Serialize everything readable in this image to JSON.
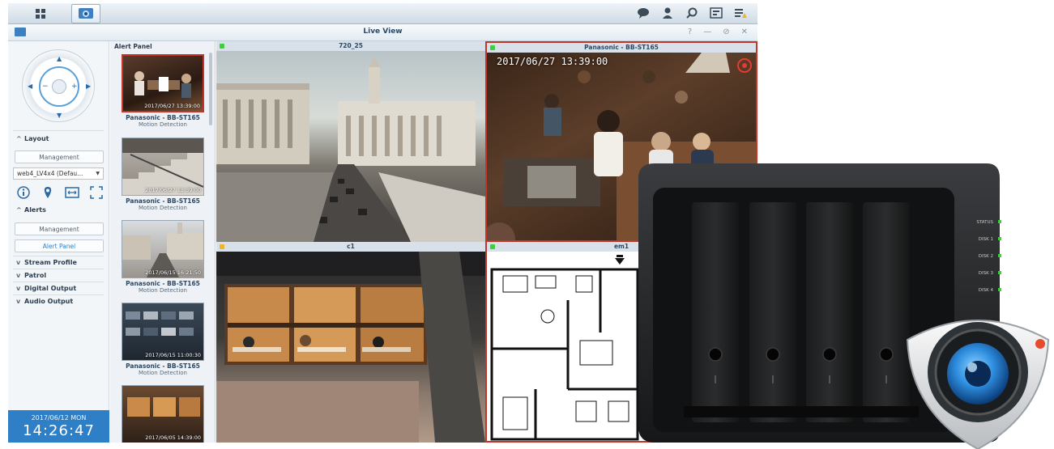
{
  "taskbar": {
    "buttons": [
      "main-menu",
      "surveillance-station"
    ],
    "right_icons": [
      "chat-icon",
      "user-icon",
      "search-icon",
      "widgets-icon",
      "notifications-icon"
    ]
  },
  "window": {
    "title": "Live View",
    "controls": [
      "?",
      "—",
      "⊘",
      "✕"
    ]
  },
  "left_panel": {
    "layout_label": "Layout",
    "layout_management": "Management",
    "layout_select": "web4_LV4x4 (Defau...",
    "alerts_label": "Alerts",
    "alerts_management": "Management",
    "alert_panel_button": "Alert Panel",
    "stream_profile": "Stream Profile",
    "patrol": "Patrol",
    "digital_output": "Digital Output",
    "audio_output": "Audio Output",
    "clock_date": "2017/06/12  MON",
    "clock_time": "14:26:47"
  },
  "alert_panel": {
    "title": "Alert Panel",
    "alerts": [
      {
        "timestamp": "2017/06/27 13:39:00",
        "camera": "Panasonic - BB-ST165",
        "event": "Motion Detection"
      },
      {
        "timestamp": "2017/06/27 13:39:00",
        "camera": "Panasonic - BB-ST165",
        "event": "Motion Detection"
      },
      {
        "timestamp": "2017/06/15 16:21:50",
        "camera": "Panasonic - BB-ST165",
        "event": "Motion Detection"
      },
      {
        "timestamp": "2017/06/15 11:00:30",
        "camera": "Panasonic - BB-ST165",
        "event": "Motion Detection"
      },
      {
        "timestamp": "2017/06/05 14:39:00",
        "camera": "",
        "event": ""
      }
    ]
  },
  "cameras": [
    {
      "label": "720_25",
      "osd": ""
    },
    {
      "label": "Panasonic - BB-ST165",
      "osd": "2017/06/27   13:39:00"
    },
    {
      "label": "c1",
      "osd": ""
    },
    {
      "label": "em1",
      "osd": ""
    }
  ],
  "nas": {
    "leds": [
      "STATUS",
      "DISK 1",
      "DISK 2",
      "DISK 3",
      "DISK 4"
    ]
  },
  "colors": {
    "accent": "#2f7fc6",
    "selected_border": "#c2352b",
    "led_green": "#3ad13a"
  }
}
